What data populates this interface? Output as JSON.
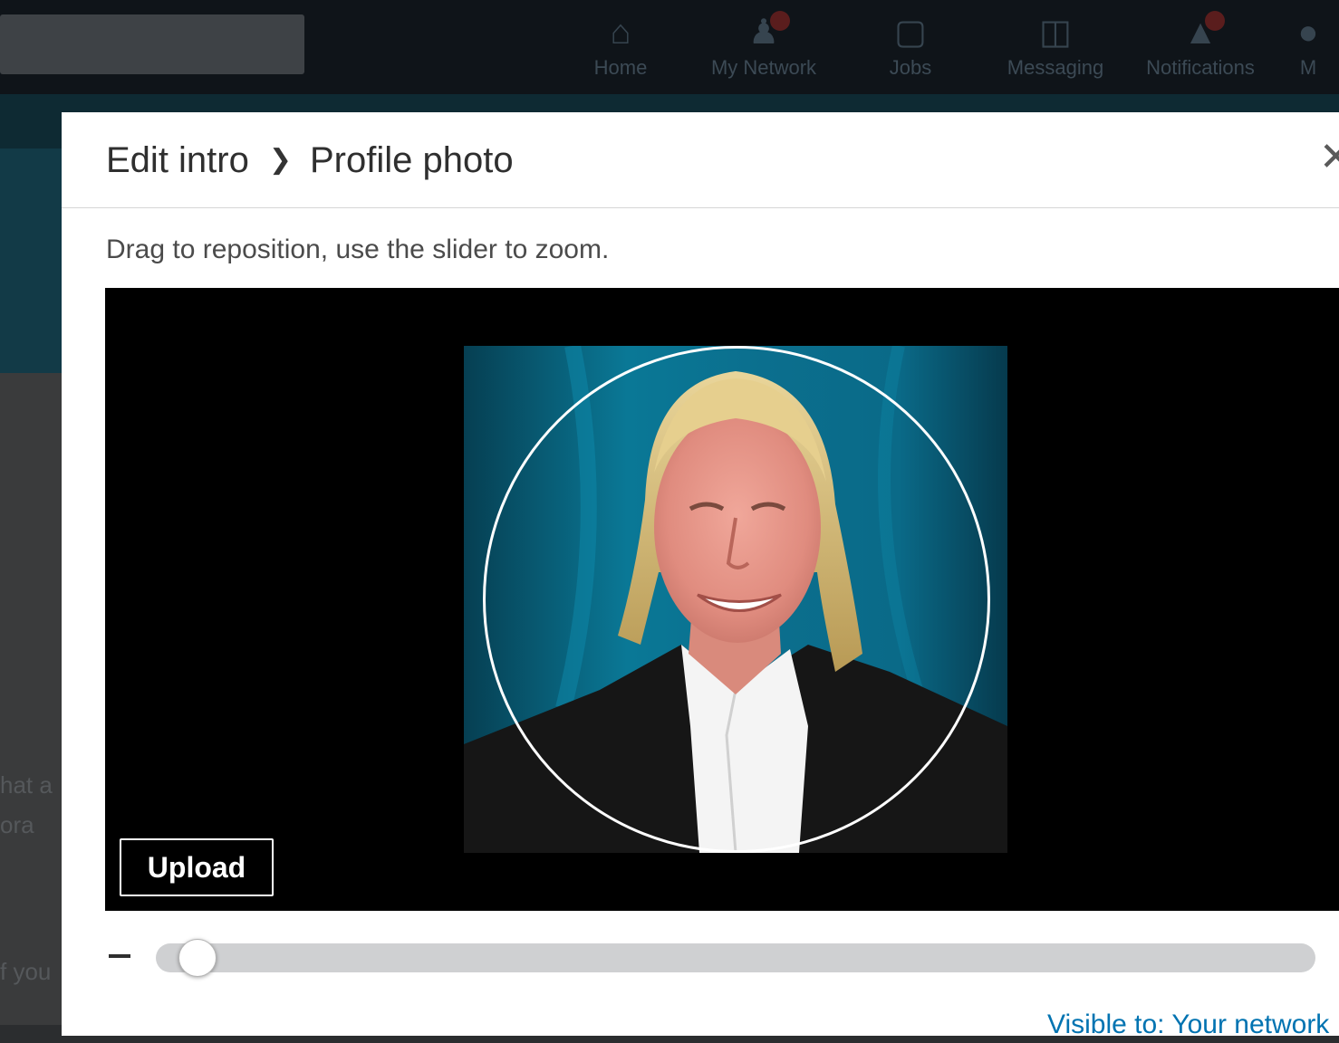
{
  "background": {
    "nav_items": [
      {
        "label": "Home",
        "icon": "home-icon",
        "badge": false
      },
      {
        "label": "My Network",
        "icon": "network-icon",
        "badge": true
      },
      {
        "label": "Jobs",
        "icon": "briefcase-icon",
        "badge": false
      },
      {
        "label": "Messaging",
        "icon": "messaging-icon",
        "badge": false
      },
      {
        "label": "Notifications",
        "icon": "bell-icon",
        "badge": true
      },
      {
        "label": "M",
        "icon": "me-icon",
        "badge": false
      }
    ],
    "side_text": [
      "hat a",
      "ora",
      "f you"
    ]
  },
  "modal": {
    "breadcrumb_parent": "Edit intro",
    "breadcrumb_current": "Profile photo",
    "instruction": "Drag to reposition, use the slider to zoom.",
    "upload_label": "Upload",
    "visibility_label": "Visible to: Your network"
  },
  "zoom": {
    "level": 0
  },
  "colors": {
    "accent": "#0073b1",
    "photo_background": "#0a6f8c",
    "editor_background": "#000000"
  }
}
